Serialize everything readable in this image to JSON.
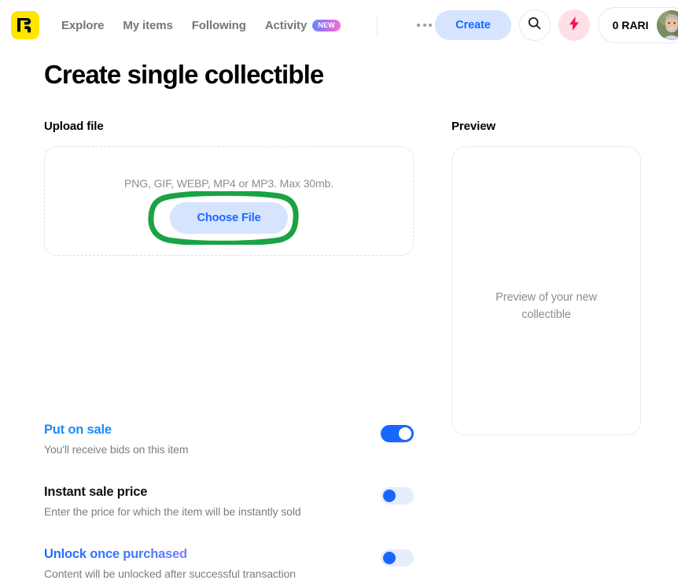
{
  "header": {
    "logo_icon": "rarible-logo-icon",
    "nav": [
      {
        "label": "Explore"
      },
      {
        "label": "My items"
      },
      {
        "label": "Following"
      },
      {
        "label": "Activity",
        "badge": "NEW"
      }
    ],
    "more_icon": "ellipsis-icon",
    "create_label": "Create",
    "search_icon": "search-icon",
    "bolt_icon": "lightning-bolt-icon",
    "wallet_amount": "0 RARI",
    "avatar_icon": "user-avatar"
  },
  "page": {
    "title": "Create single collectible"
  },
  "upload": {
    "section_label": "Upload file",
    "hint": "PNG, GIF, WEBP, MP4 or MP3. Max 30mb.",
    "choose_label": "Choose File",
    "highlight_color": "#1aa345"
  },
  "options": [
    {
      "title": "Put on sale",
      "subtitle": "You'll receive bids on this item",
      "state": "on"
    },
    {
      "title": "Instant sale price",
      "subtitle": "Enter the price for which the item will be instantly sold",
      "state": "off"
    },
    {
      "title_part_1": "Unlock once ",
      "title_part_2": "purchased",
      "title": "Unlock once purchased",
      "subtitle": "Content will be unlocked after successful transaction",
      "state": "off"
    }
  ],
  "preview": {
    "section_label": "Preview",
    "empty_text": "Preview of your new collectible"
  },
  "colors": {
    "accent_blue": "#1868ff",
    "brand_yellow": "#ffe600",
    "pink": "#ffdfe6",
    "annotation_green": "#1aa345"
  }
}
